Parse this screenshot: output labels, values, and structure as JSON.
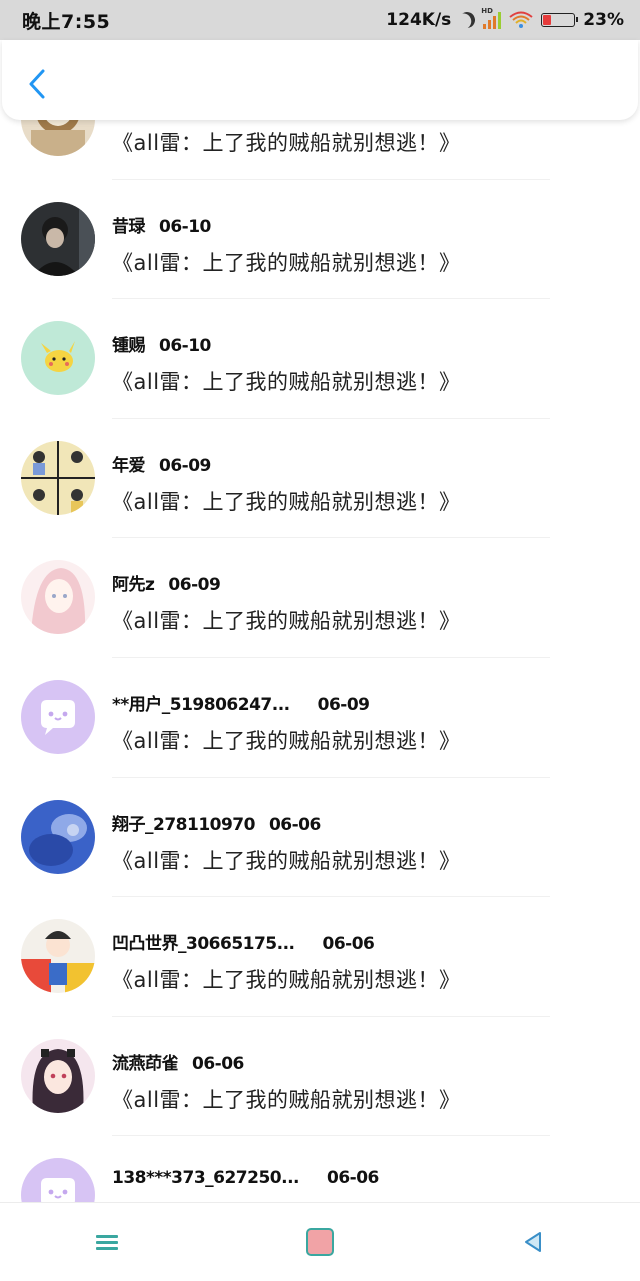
{
  "status_bar": {
    "time": "晚上7:55",
    "speed": "124K/s",
    "battery": "23%",
    "battery_level": 0.23,
    "icons": [
      "moon-icon",
      "hd-signal-icon",
      "wifi-icon",
      "battery-icon"
    ]
  },
  "header": {
    "back_icon": "chevron-left-icon",
    "accent": "#2196F3"
  },
  "items": [
    {
      "name": "",
      "date": "",
      "message": "《all雷：上了我的贼船就别想逃！》",
      "avatar": "watch"
    },
    {
      "name": "昔琭",
      "date": "06-10",
      "message": "《all雷：上了我的贼船就别想逃！》",
      "avatar": "dark-photo"
    },
    {
      "name": "锺赐",
      "date": "06-10",
      "message": "《all雷：上了我的贼船就别想逃！》",
      "avatar": "pikachu"
    },
    {
      "name": "年爱",
      "date": "06-09",
      "message": "《all雷：上了我的贼船就别想逃！》",
      "avatar": "collage"
    },
    {
      "name": "阿先z",
      "date": "06-09",
      "message": "《all雷：上了我的贼船就别想逃！》",
      "avatar": "anime-girl-light"
    },
    {
      "name": "**用户_519806247...",
      "date": "06-09",
      "message": "《all雷：上了我的贼船就别想逃！》",
      "avatar": "chat-default"
    },
    {
      "name": "翔子_278110970",
      "date": "06-06",
      "message": "《all雷：上了我的贼船就别想逃！》",
      "avatar": "blue"
    },
    {
      "name": "凹凸世界_30665175...",
      "date": "06-06",
      "message": "《all雷：上了我的贼船就别想逃！》",
      "avatar": "colorful"
    },
    {
      "name": "流燕茚雀",
      "date": "06-06",
      "message": "《all雷：上了我的贼船就别想逃！》",
      "avatar": "anime-girl-dark"
    },
    {
      "name": "138***373_627250...",
      "date": "06-06",
      "message": "",
      "avatar": "chat-default"
    }
  ],
  "nav": {
    "icons": [
      "menu-icon",
      "home-icon",
      "back-triangle-icon"
    ]
  }
}
